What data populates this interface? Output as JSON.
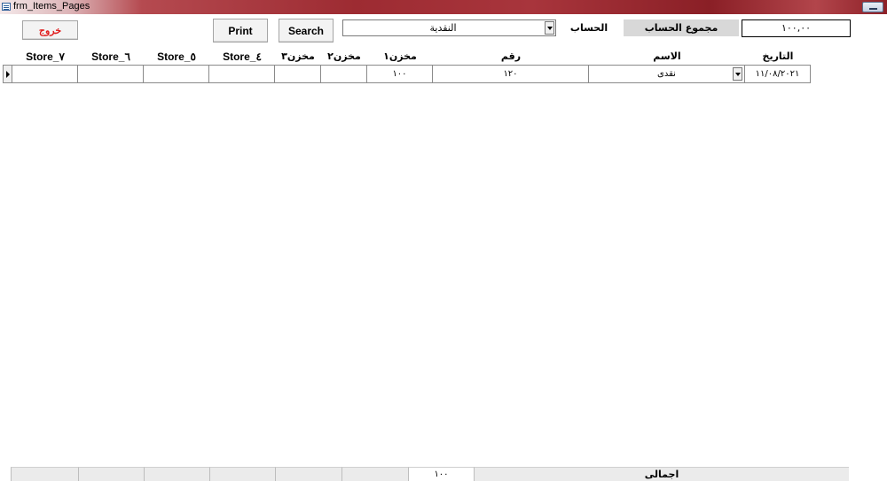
{
  "window": {
    "title": "frm_Items_Pages"
  },
  "toolbar": {
    "exit_label": "خروج",
    "print_label": "Print",
    "search_label": "Search",
    "account_value": "النقدية",
    "account_label": "الحساب",
    "account_total_label": "مجموع الحساب",
    "account_total_value": "١٠٠,٠٠"
  },
  "columns": {
    "store7": "Store_٧",
    "store6": "Store_٦",
    "store5": "Store_٥",
    "store4": "Store_٤",
    "store3": "مخزن٣",
    "store2": "مخزن٢",
    "store1": "مخزن١",
    "number": "رقم",
    "name": "الاسم",
    "date": "التاريخ"
  },
  "rows": [
    {
      "store7": "",
      "store6": "",
      "store5": "",
      "store4": "",
      "store3": "",
      "store2": "",
      "store1": "١٠٠",
      "number": "١٢٠",
      "name": "نقدى",
      "date": "١١/٠٨/٢٠٢١"
    }
  ],
  "footer": {
    "store1_total": "١٠٠",
    "total_label": "اجمالى"
  },
  "colors": {
    "exit_text": "#e01c1c",
    "label_bg": "#d8d8d8",
    "footer_bg": "#ebebeb"
  }
}
